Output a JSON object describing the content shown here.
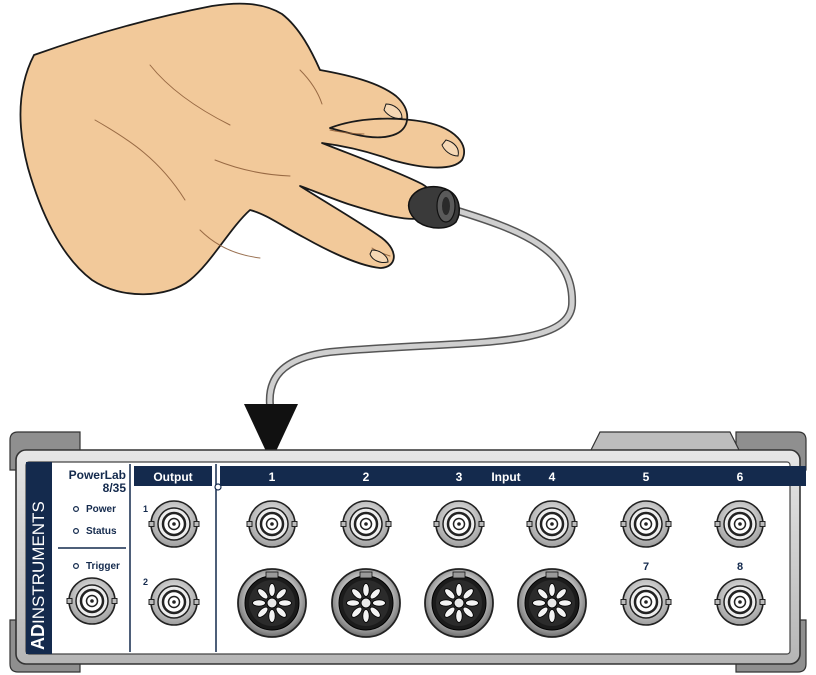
{
  "device": {
    "brand_bold": "AD",
    "brand_rest": "INSTRUMENTS",
    "model_name": "PowerLab",
    "model_number": "8/35",
    "indicators": {
      "power": "Power",
      "status": "Status",
      "trigger": "Trigger"
    },
    "output": {
      "title": "Output",
      "channels": [
        "1",
        "2"
      ]
    },
    "input": {
      "title": "Input",
      "channels_top": [
        "1",
        "2",
        "3",
        "4",
        "5",
        "6"
      ],
      "channels_bottom_bnc": [
        "7",
        "8"
      ]
    }
  },
  "colors": {
    "panel_header": "#142a4d",
    "brand_bar": "#142a4d",
    "case": "#c9c9c9",
    "case_dark": "#8f8f8f",
    "skin": "#f2c99a",
    "skin_outline": "#1a1a1a",
    "cable": "#cfcfcf",
    "sensor": "#3a3a3a"
  },
  "icons": {
    "pointer_arrow": "arrow-down-icon",
    "bnc_connector": "bnc-connector-icon",
    "pod_connector": "pod-din-connector-icon",
    "led": "led-indicator-icon"
  }
}
